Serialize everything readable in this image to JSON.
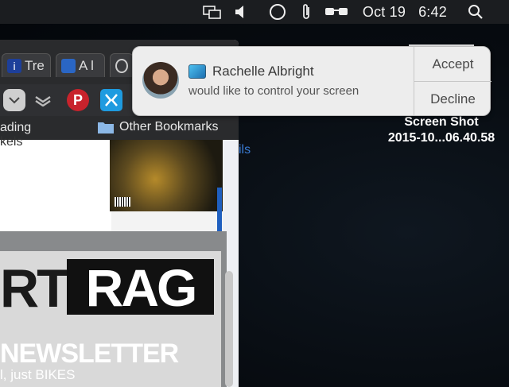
{
  "menubar": {
    "date": "Oct 19",
    "time": "6:42",
    "icons": [
      "screen-mirroring-icon",
      "volume-icon",
      "circle-icon",
      "paperclip-icon",
      "glasses-icon",
      "spotlight-search-icon"
    ]
  },
  "browser": {
    "tabs": [
      {
        "label": "Tre",
        "icon": "info-icon"
      },
      {
        "label": "A l",
        "icon": "book-icon"
      }
    ],
    "bookmarks": {
      "left_label": "ading",
      "other_label": "Other Bookmarks"
    },
    "page": {
      "partial_text": "kels",
      "logo_left": "RT",
      "logo_right": "RAG",
      "newsletter": "NEWSLETTER",
      "tagline": "l, just BIKES",
      "link_fragment": "ils"
    }
  },
  "desktop": {
    "file_label_line1": "Screen Shot",
    "file_label_line2": "2015-10...06.40.58"
  },
  "notification": {
    "sender": "Rachelle Albright",
    "message": "would like to control your screen",
    "accept": "Accept",
    "decline": "Decline"
  }
}
